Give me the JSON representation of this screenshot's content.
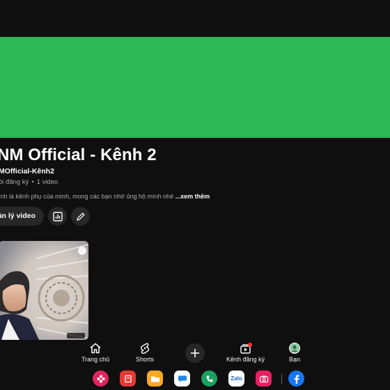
{
  "colors": {
    "background": "#0f0f0f",
    "banner": "#2bb855",
    "chip": "#272727",
    "secondary_text": "#aaaaaa",
    "notification_dot": "#ff2d2d"
  },
  "channel": {
    "title": "NM Official - Kênh 2",
    "handle": "MOfficial-Kênh2",
    "subscribers": "ồi đăng ký",
    "separator": "•",
    "video_count": "1 video",
    "description": "ình là kênh phụ của mình, mong các bạn nhớ ủng hộ mình nhé",
    "more_label": "...xem thêm"
  },
  "actions": {
    "manage_videos": "ản lý video",
    "analytics_icon": "bar-chart-icon",
    "edit_icon": "pencil-icon"
  },
  "bottom_nav": {
    "items": [
      {
        "label": "Trang chủ",
        "icon": "home-icon"
      },
      {
        "label": "Shorts",
        "icon": "shorts-icon"
      },
      {
        "label": "",
        "icon": "create-plus-icon"
      },
      {
        "label": "Kênh đăng ký",
        "icon": "subscriptions-icon"
      },
      {
        "label": "Bạn",
        "icon": "avatar-icon"
      }
    ]
  },
  "dock": {
    "apps": [
      {
        "name": "flower-app-icon",
        "color": "#e0245e"
      },
      {
        "name": "red-app-icon",
        "color": "#e53935"
      },
      {
        "name": "folder-app-icon",
        "color": "#f9a825"
      },
      {
        "name": "messages-app-icon",
        "color": "#1e88e5"
      },
      {
        "name": "phone-app-icon",
        "color": "#1aa260"
      },
      {
        "name": "zalo-app-icon",
        "color": "#1565c0",
        "text": "Zalo"
      },
      {
        "name": "camera-app-icon",
        "color": "#e91e63"
      },
      {
        "name": "facebook-app-icon",
        "color": "#1877f2"
      }
    ]
  }
}
